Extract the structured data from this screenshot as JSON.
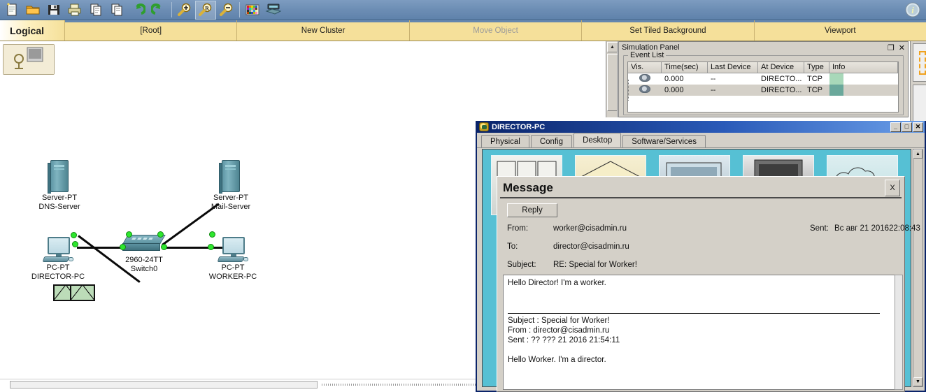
{
  "toolbar": {
    "buttons": [
      {
        "name": "new-file-icon",
        "title": "New"
      },
      {
        "name": "open-folder-icon",
        "title": "Open"
      },
      {
        "name": "save-icon",
        "title": "Save"
      },
      {
        "name": "print-icon",
        "title": "Print"
      },
      {
        "name": "copy-icon",
        "title": "Copy"
      },
      {
        "name": "paste-icon",
        "title": "Paste"
      },
      {
        "name": "undo-icon",
        "title": "Undo"
      },
      {
        "name": "redo-icon",
        "title": "Redo"
      },
      {
        "name": "zoom-in-icon",
        "title": "Zoom In"
      },
      {
        "name": "zoom-reset-icon",
        "title": "Zoom Reset"
      },
      {
        "name": "zoom-out-icon",
        "title": "Zoom Out"
      },
      {
        "name": "palette-icon",
        "title": "Palette"
      },
      {
        "name": "custom-devices-icon",
        "title": "Custom Devices"
      }
    ],
    "info_icon_label": "i"
  },
  "viewbar": {
    "mode": "Logical",
    "cells": [
      {
        "label": "[Root]",
        "dim": false
      },
      {
        "label": "New Cluster",
        "dim": false
      },
      {
        "label": "Move Object",
        "dim": true
      },
      {
        "label": "Set Tiled Background",
        "dim": false
      },
      {
        "label": "Viewport",
        "dim": false
      }
    ]
  },
  "topology": {
    "nodes": [
      {
        "id": "dns",
        "type": "Server-PT",
        "name": "DNS-Server"
      },
      {
        "id": "mail",
        "type": "Server-PT",
        "name": "Mail-Server"
      },
      {
        "id": "director",
        "type": "PC-PT",
        "name": "DIRECTOR-PC"
      },
      {
        "id": "switch",
        "type": "2960-24TT",
        "name": "Switch0"
      },
      {
        "id": "worker",
        "type": "PC-PT",
        "name": "WORKER-PC"
      }
    ]
  },
  "simulation_panel": {
    "title": "Simulation Panel",
    "restore_glyph": "❐",
    "close_glyph": "✕",
    "group_label": "Event List",
    "columns": [
      "Vis.",
      "Time(sec)",
      "Last Device",
      "At Device",
      "Type",
      "Info"
    ],
    "rows": [
      {
        "vis": "eye-icon",
        "time": "0.000",
        "last_device": "--",
        "at_device": "DIRECTO...",
        "type": "TCP",
        "info_color": "#a8d8b9"
      },
      {
        "vis": "eye-icon",
        "time": "0.000",
        "last_device": "--",
        "at_device": "DIRECTO...",
        "type": "TCP",
        "info_color": "#6aa89b"
      }
    ]
  },
  "device_window": {
    "title": "DIRECTOR-PC",
    "window_buttons": {
      "minimize": "_",
      "maximize": "□",
      "close": "✕"
    },
    "tabs": [
      {
        "label": "Physical",
        "active": false
      },
      {
        "label": "Config",
        "active": false
      },
      {
        "label": "Desktop",
        "active": true
      },
      {
        "label": "Software/Services",
        "active": false
      }
    ]
  },
  "message_dialog": {
    "title": "Message",
    "close_label": "X",
    "reply_label": "Reply",
    "fields": {
      "from_label": "From:",
      "from_value": "worker@cisadmin.ru",
      "to_label": "To:",
      "to_value": "director@cisadmin.ru",
      "subject_label": "Subject:",
      "subject_value": "RE: Special for Worker!",
      "sent_label": "Sent:",
      "sent_value": "Вс авг 21 201622:08:43"
    },
    "body_top": "Hello Director! I'm a worker.",
    "body_quoted": "Subject : Special for Worker!\nFrom : director@cisadmin.ru\nSent : ?? ??? 21 2016 21:54:11\n\nHello Worker. I'm a director."
  },
  "colors": {
    "toolbar_blue": "#6c8db4",
    "viewbar_yellow": "#f5e09a",
    "titlebar_blue": "#0a246a",
    "desktop_cyan": "#56c0d4",
    "dialog_gray": "#d4d0c8",
    "led_green": "#2ee62e"
  }
}
